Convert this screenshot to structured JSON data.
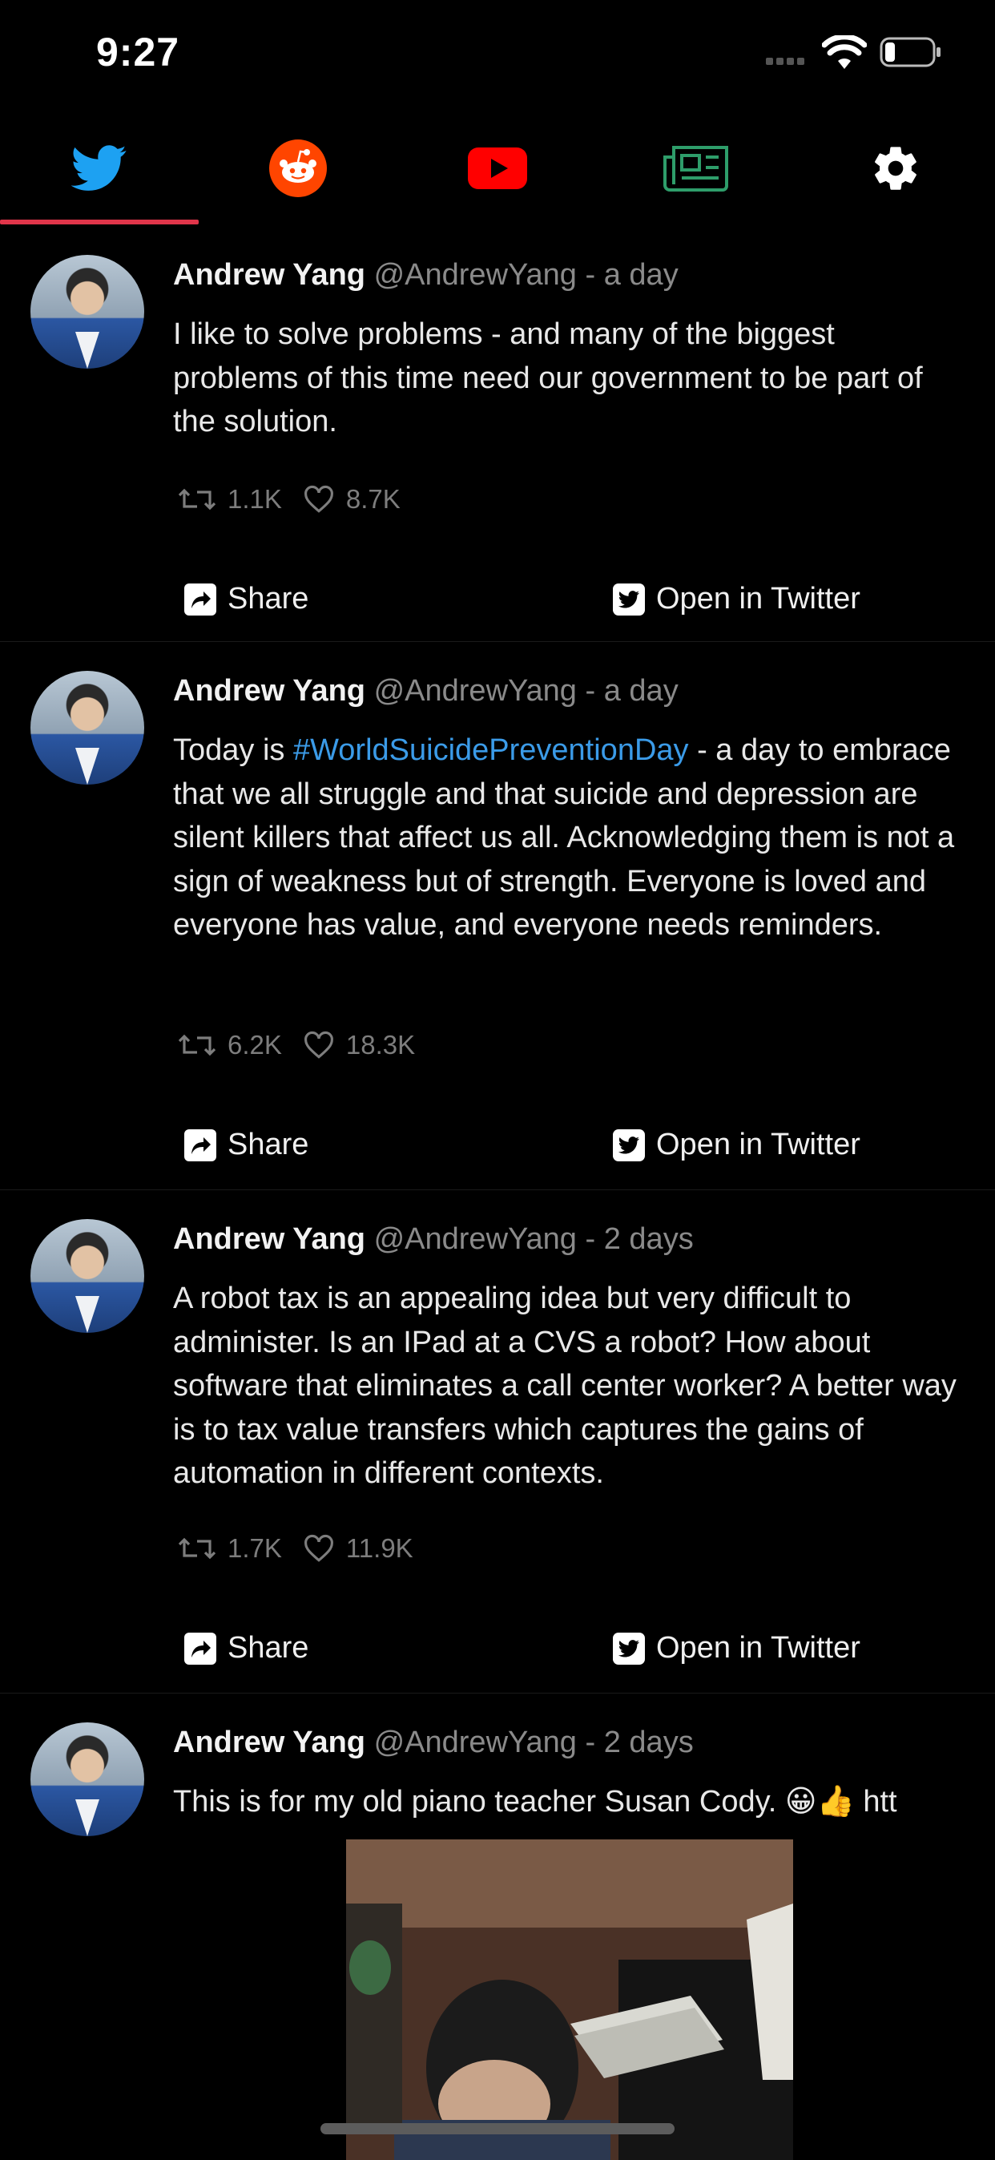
{
  "status_bar": {
    "time": "9:27"
  },
  "tabs": [
    {
      "name": "twitter",
      "icon": "twitter-bird-icon",
      "color": "#1da1f2",
      "selected": true
    },
    {
      "name": "reddit",
      "icon": "reddit-icon",
      "color": "#ff4500"
    },
    {
      "name": "youtube",
      "icon": "youtube-icon",
      "color": "#ff0000"
    },
    {
      "name": "news",
      "icon": "newspaper-icon",
      "color": "#2e9d6a"
    },
    {
      "name": "settings",
      "icon": "gear-icon",
      "color": "#ffffff"
    }
  ],
  "accent_color": "#e0354a",
  "tweets": [
    {
      "author": "Andrew Yang",
      "handle": "@AndrewYang",
      "separator": "-",
      "time_ago": "a day",
      "text_before": "I like to solve problems - and many of the biggest problems of this time need our government to be part of the solution.",
      "hashtag": "",
      "text_after": "",
      "retweets": "1.1K",
      "likes": "8.7K",
      "share_label": "Share",
      "open_label": "Open in Twitter"
    },
    {
      "author": "Andrew Yang",
      "handle": "@AndrewYang",
      "separator": "-",
      "time_ago": "a day",
      "text_before": "Today is ",
      "hashtag": "#WorldSuicidePreventionDay",
      "text_after": " - a day to embrace that we all struggle and that suicide and depression are silent killers that affect us all. Acknowledging them is not a sign of weakness but of strength. Everyone is loved and everyone has value, and everyone needs reminders.",
      "retweets": "6.2K",
      "likes": "18.3K",
      "share_label": "Share",
      "open_label": "Open in Twitter"
    },
    {
      "author": "Andrew Yang",
      "handle": "@AndrewYang",
      "separator": "-",
      "time_ago": "2 days",
      "text_before": "A robot tax is an appealing idea but very difficult to administer. Is an IPad at a CVS a robot? How about software that eliminates a call center worker? A better way is to tax value transfers which captures the gains of automation in different contexts.",
      "hashtag": "",
      "text_after": "",
      "retweets": "1.7K",
      "likes": "11.9K",
      "share_label": "Share",
      "open_label": "Open in Twitter"
    },
    {
      "author": "Andrew Yang",
      "handle": "@AndrewYang",
      "separator": "-",
      "time_ago": "2 days",
      "text_before": "This is for my old piano teacher Susan Cody. 😀👍 htt",
      "hashtag": "",
      "text_after": ""
    }
  ]
}
